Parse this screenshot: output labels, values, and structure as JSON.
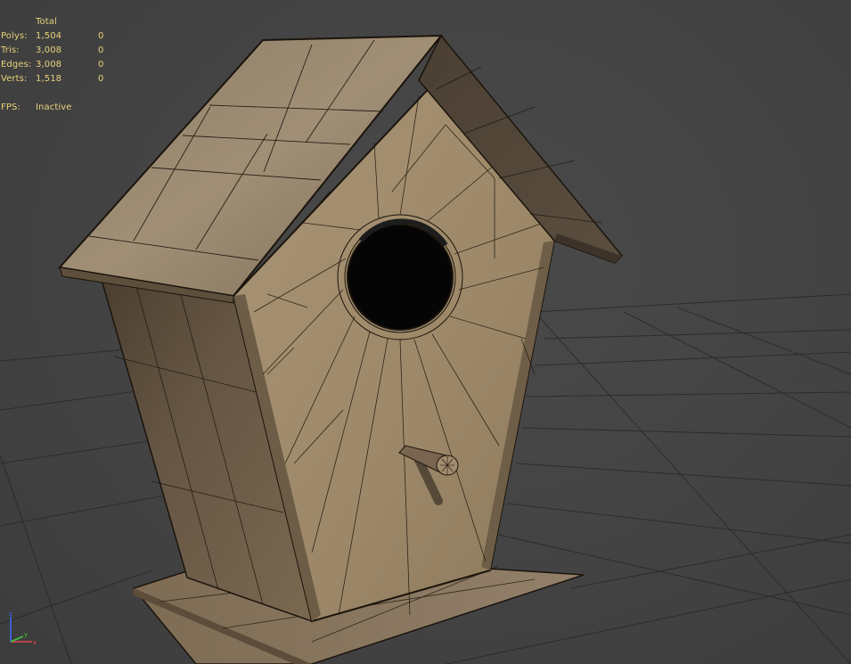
{
  "viewport": {
    "top_text": "' ' ' ' ' ' ' ' ' ' ' ' '",
    "stats": {
      "header": "Total",
      "rows": [
        {
          "label": "Polys:",
          "total": "1,504",
          "selected": "0"
        },
        {
          "label": "Tris:",
          "total": "3,008",
          "selected": "0"
        },
        {
          "label": "Edges:",
          "total": "3,008",
          "selected": "0"
        },
        {
          "label": "Verts:",
          "total": "1,518",
          "selected": "0"
        }
      ],
      "fps_label": "FPS:",
      "fps_value": "Inactive"
    },
    "colors": {
      "stats_text": "#e7d27a",
      "background": "#454545",
      "wireframe": "#1b140c",
      "wood_light": "#9e8a6b",
      "wood_dark": "#6a5a45"
    },
    "icons": [
      "view-axis-gizmo-icon"
    ]
  }
}
